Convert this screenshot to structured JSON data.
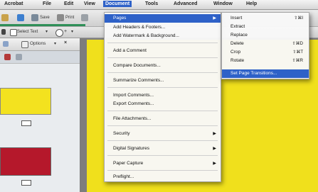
{
  "menubar": {
    "app": "Acrobat",
    "items": [
      "File",
      "Edit",
      "View",
      "Document",
      "Tools",
      "Advanced",
      "Window",
      "Help"
    ],
    "active": "Document"
  },
  "toolbar": {
    "save": "Save",
    "print": "Print",
    "select_text": "Select Text",
    "zoom_in": "+"
  },
  "leftpane": {
    "options": "Options"
  },
  "document_menu": {
    "items": [
      {
        "label": "Pages",
        "submenu": true,
        "highlighted": true
      },
      {
        "label": "Add Headers & Footers..."
      },
      {
        "label": "Add Watermark & Background..."
      },
      {
        "label": "Add a Comment"
      },
      {
        "label": "Compare Documents..."
      },
      {
        "label": "Summarize Comments..."
      },
      {
        "label": "Import Comments..."
      },
      {
        "label": "Export Comments..."
      },
      {
        "label": "File Attachments..."
      },
      {
        "label": "Security",
        "submenu": true
      },
      {
        "label": "Digital Signatures",
        "submenu": true
      },
      {
        "label": "Paper Capture",
        "submenu": true
      },
      {
        "label": "Preflight..."
      }
    ]
  },
  "pages_submenu": {
    "items": [
      {
        "label": "Insert",
        "shortcut": "⇧⌘I"
      },
      {
        "label": "Extract",
        "shortcut": ""
      },
      {
        "label": "Replace",
        "shortcut": ""
      },
      {
        "label": "Delete",
        "shortcut": "⇧⌘D"
      },
      {
        "label": "Crop",
        "shortcut": "⇧⌘T"
      },
      {
        "label": "Rotate",
        "shortcut": "⇧⌘R"
      },
      {
        "label": "Set Page Transitions...",
        "shortcut": "",
        "highlighted": true
      }
    ]
  },
  "colors": {
    "highlight": "#2e61c8",
    "page": "#f0e01c",
    "thumb_yellow": "#f3e21f",
    "thumb_red": "#b5182b"
  }
}
